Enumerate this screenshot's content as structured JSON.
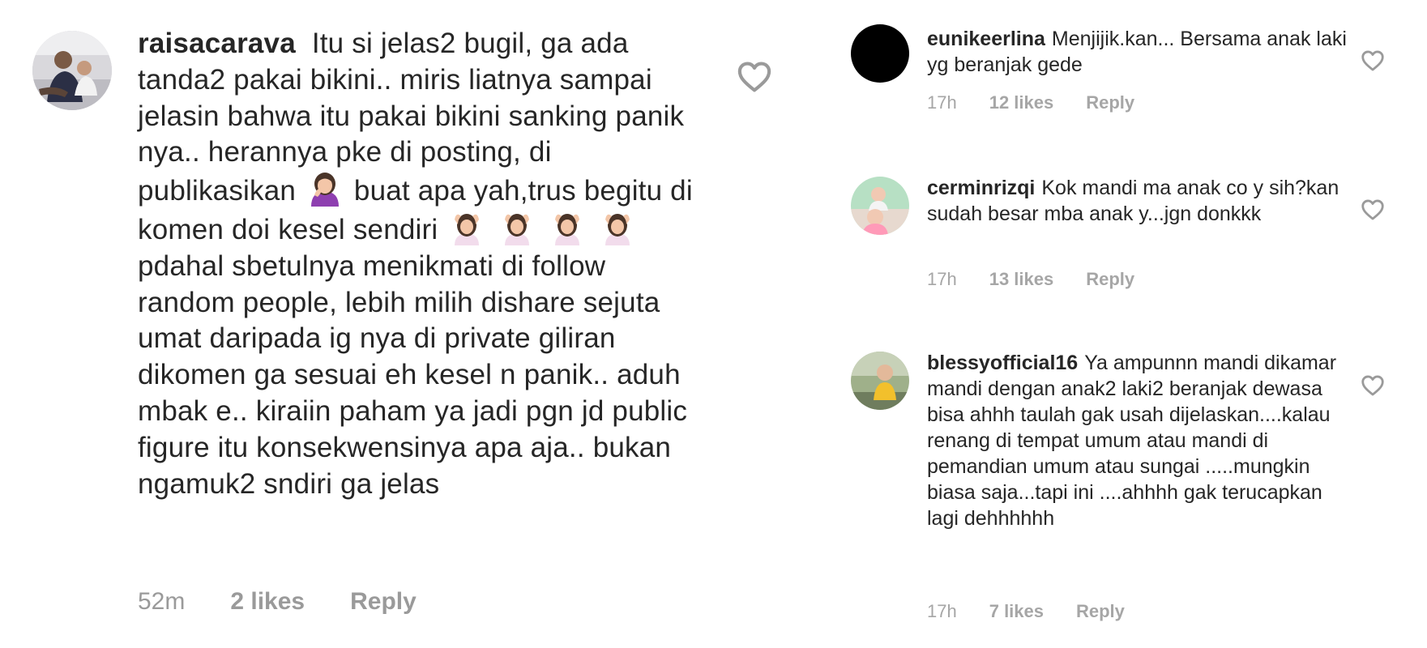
{
  "main_comment": {
    "username": "raisacarava",
    "text_parts": [
      "Itu si jelas2 bugil, ga ada tanda2 pakai bikini.. miris liatnya sampai jelasin bahwa itu pakai bikini sanking panik nya.. herannya pke di posting, di publikasikan",
      "buat apa yah,trus begitu di komen doi kesel sendiri",
      "pdahal sbetulnya menikmati di follow random people, lebih milih dishare sejuta umat daripada ig nya di private giliran dikomen ga sesuai eh kesel n panik.. aduh mbak e.. kiraiin paham ya jadi pgn jd public figure itu konsekwensinya apa aja.. bukan ngamuk2 sndiri ga jelas"
    ],
    "time": "52m",
    "likes": "2 likes",
    "reply": "Reply",
    "emoji": [
      "facepalm-woman-emoji",
      "ok-woman-emoji"
    ]
  },
  "side_comments": [
    {
      "username": "eunikeerlina",
      "text": "Menjijik.kan... Bersama anak laki yg beranjak gede",
      "time": "17h",
      "likes": "12 likes",
      "reply": "Reply"
    },
    {
      "username": "cerminrizqi",
      "text": "Kok mandi ma anak co y sih?kan sudah besar mba anak y...jgn donkkk",
      "time": "17h",
      "likes": "13 likes",
      "reply": "Reply"
    },
    {
      "username": "blessyofficial16",
      "text": "Ya ampunnn mandi dikamar mandi dengan anak2 laki2 beranjak dewasa bisa ahhh taulah gak usah dijelaskan....kalau renang di tempat umum atau mandi di pemandian umum atau sungai .....mungkin biasa saja...tapi ini ....ahhhh gak terucapkan lagi dehhhhhh",
      "time": "17h",
      "likes": "7 likes",
      "reply": "Reply"
    }
  ],
  "colors": {
    "text": "#262626",
    "meta": "#9a9a9a",
    "heart_outline": "#9a9a9a",
    "background": "#ffffff"
  },
  "icons": {
    "like": "heart-outline-icon"
  }
}
